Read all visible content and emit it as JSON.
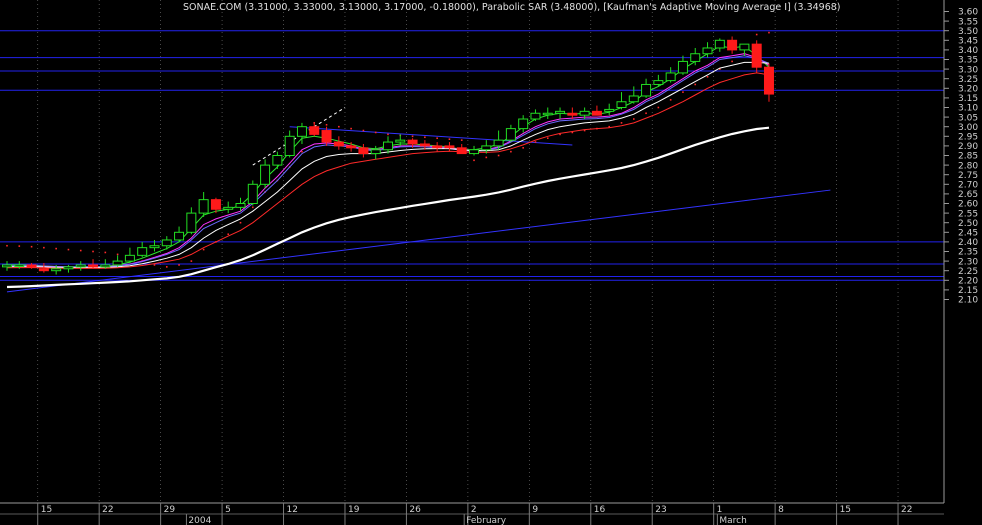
{
  "chart_data": {
    "type": "candlestick",
    "title": "SONAE.COM (3.31000, 3.33000, 3.13000, 3.17000, -0.18000), Parabolic SAR (3.48000), [Kaufman's Adaptive Moving Average I] (3.34968)",
    "ylim": [
      2.08,
      3.62
    ],
    "y_ticks": [
      2.1,
      2.15,
      2.2,
      2.25,
      2.3,
      2.35,
      2.4,
      2.45,
      2.5,
      2.55,
      2.6,
      2.65,
      2.7,
      2.75,
      2.8,
      2.85,
      2.9,
      2.95,
      3.0,
      3.05,
      3.1,
      3.15,
      3.2,
      3.25,
      3.3,
      3.35,
      3.4,
      3.45,
      3.5,
      3.55,
      3.6
    ],
    "x_week_labels": [
      {
        "index": 3,
        "label": "15"
      },
      {
        "index": 8,
        "label": "22"
      },
      {
        "index": 13,
        "label": "29"
      },
      {
        "index": 18,
        "label": "5"
      },
      {
        "index": 23,
        "label": "12"
      },
      {
        "index": 28,
        "label": "19"
      },
      {
        "index": 33,
        "label": "26"
      },
      {
        "index": 38,
        "label": "2"
      },
      {
        "index": 43,
        "label": "9"
      },
      {
        "index": 48,
        "label": "16"
      },
      {
        "index": 53,
        "label": "23"
      },
      {
        "index": 58,
        "label": "1"
      },
      {
        "index": 63,
        "label": "8"
      },
      {
        "index": 68,
        "label": "15"
      },
      {
        "index": 73,
        "label": "22"
      }
    ],
    "x_month_labels": [
      {
        "index": 14.6,
        "label": "2004"
      },
      {
        "index": 37.2,
        "label": "February"
      },
      {
        "index": 57.8,
        "label": "March"
      }
    ],
    "horizontal_lines": [
      3.5,
      3.36,
      3.29,
      3.19,
      2.4,
      2.285,
      2.22,
      2.2
    ],
    "trendlines": [
      {
        "from": [
          0,
          2.14
        ],
        "to": [
          67,
          2.67
        ],
        "color": "#3333ff"
      },
      {
        "from": [
          23,
          3.0
        ],
        "to": [
          46,
          2.905
        ],
        "color": "#3333ff"
      },
      {
        "from": [
          20,
          2.8
        ],
        "to": [
          27.5,
          3.1
        ],
        "color": "#ffffff",
        "dashed": true
      }
    ],
    "candles": {
      "open": [
        2.27,
        2.28,
        2.28,
        2.26,
        2.25,
        2.26,
        2.27,
        2.28,
        2.27,
        2.28,
        2.3,
        2.33,
        2.37,
        2.38,
        2.41,
        2.45,
        2.55,
        2.62,
        2.57,
        2.58,
        2.6,
        2.7,
        2.8,
        2.85,
        2.95,
        3.0,
        2.98,
        2.92,
        2.9,
        2.89,
        2.86,
        2.88,
        2.92,
        2.93,
        2.91,
        2.9,
        2.9,
        2.89,
        2.86,
        2.88,
        2.9,
        2.93,
        2.99,
        3.04,
        3.07,
        3.07,
        3.07,
        3.06,
        3.08,
        3.08,
        3.1,
        3.13,
        3.16,
        3.22,
        3.24,
        3.28,
        3.34,
        3.38,
        3.41,
        3.45,
        3.4,
        3.43,
        3.31
      ],
      "high": [
        2.3,
        2.3,
        2.29,
        2.29,
        2.28,
        2.28,
        2.3,
        2.31,
        2.31,
        2.33,
        2.37,
        2.4,
        2.41,
        2.43,
        2.48,
        2.58,
        2.66,
        2.63,
        2.61,
        2.63,
        2.72,
        2.83,
        2.87,
        2.98,
        3.02,
        3.02,
        3.0,
        2.95,
        2.92,
        2.91,
        2.9,
        2.95,
        2.96,
        2.94,
        2.93,
        2.92,
        2.92,
        2.91,
        2.9,
        2.93,
        2.98,
        3.01,
        3.06,
        3.09,
        3.1,
        3.1,
        3.1,
        3.1,
        3.11,
        3.12,
        3.18,
        3.21,
        3.25,
        3.27,
        3.31,
        3.37,
        3.41,
        3.44,
        3.46,
        3.47,
        3.43,
        3.45,
        3.33
      ],
      "low": [
        2.25,
        2.26,
        2.26,
        2.24,
        2.23,
        2.24,
        2.25,
        2.26,
        2.26,
        2.27,
        2.29,
        2.32,
        2.35,
        2.36,
        2.4,
        2.44,
        2.53,
        2.55,
        2.55,
        2.56,
        2.59,
        2.68,
        2.78,
        2.84,
        2.91,
        2.95,
        2.9,
        2.88,
        2.87,
        2.84,
        2.83,
        2.86,
        2.9,
        2.89,
        2.88,
        2.87,
        2.87,
        2.86,
        2.85,
        2.86,
        2.88,
        2.92,
        2.97,
        3.03,
        3.04,
        3.04,
        3.04,
        3.04,
        3.06,
        3.06,
        3.09,
        3.12,
        3.15,
        3.21,
        3.23,
        3.27,
        3.32,
        3.36,
        3.39,
        3.38,
        3.37,
        3.28,
        3.13
      ],
      "close": [
        2.28,
        2.28,
        2.27,
        2.25,
        2.26,
        2.27,
        2.28,
        2.27,
        2.28,
        2.3,
        2.33,
        2.37,
        2.38,
        2.41,
        2.45,
        2.55,
        2.62,
        2.57,
        2.58,
        2.6,
        2.7,
        2.8,
        2.85,
        2.95,
        3.0,
        2.96,
        2.92,
        2.9,
        2.89,
        2.86,
        2.88,
        2.92,
        2.93,
        2.91,
        2.9,
        2.89,
        2.89,
        2.86,
        2.88,
        2.9,
        2.93,
        2.99,
        3.04,
        3.07,
        3.07,
        3.08,
        3.06,
        3.08,
        3.06,
        3.09,
        3.13,
        3.16,
        3.22,
        3.24,
        3.28,
        3.34,
        3.38,
        3.41,
        3.45,
        3.4,
        3.43,
        3.31,
        3.17
      ]
    },
    "series": [
      {
        "style": "dotted",
        "color": "#ff2a2a",
        "values": [
          2.38,
          2.378,
          2.375,
          2.37,
          2.365,
          2.36,
          2.355,
          2.35,
          2.345,
          2.335,
          2.32,
          2.3,
          2.28,
          2.27,
          2.28,
          2.3,
          2.36,
          2.4,
          2.44,
          2.5,
          2.58,
          2.66,
          2.72,
          2.79,
          2.87,
          3.02,
          3.01,
          3.0,
          2.99,
          2.98,
          2.97,
          2.96,
          2.955,
          2.95,
          2.945,
          2.94,
          2.935,
          2.93,
          2.825,
          2.84,
          2.85,
          2.87,
          2.89,
          2.92,
          2.94,
          2.96,
          2.97,
          2.98,
          2.99,
          3.0,
          3.02,
          3.04,
          3.07,
          3.1,
          3.14,
          3.18,
          3.22,
          3.26,
          3.3,
          3.34,
          3.38,
          3.48,
          3.49
        ]
      },
      {
        "style": "line",
        "width": 1,
        "color": "#2ee82e",
        "values": [
          2.28,
          2.28,
          2.279,
          2.275,
          2.272,
          2.27,
          2.271,
          2.271,
          2.272,
          2.28,
          2.295,
          2.315,
          2.34,
          2.365,
          2.4,
          2.47,
          2.54,
          2.56,
          2.57,
          2.59,
          2.65,
          2.73,
          2.79,
          2.87,
          2.94,
          2.95,
          2.94,
          2.925,
          2.91,
          2.89,
          2.885,
          2.9,
          2.91,
          2.91,
          2.905,
          2.9,
          2.895,
          2.88,
          2.88,
          2.89,
          2.91,
          2.95,
          3.0,
          3.04,
          3.06,
          3.07,
          3.065,
          3.07,
          3.065,
          3.075,
          3.1,
          3.13,
          3.18,
          3.21,
          3.25,
          3.3,
          3.34,
          3.38,
          3.42,
          3.41,
          3.42,
          3.37,
          3.31
        ]
      },
      {
        "style": "line",
        "width": 1,
        "color": "#ff33ff",
        "values": [
          2.275,
          2.276,
          2.276,
          2.274,
          2.272,
          2.27,
          2.27,
          2.27,
          2.271,
          2.275,
          2.285,
          2.3,
          2.32,
          2.34,
          2.37,
          2.42,
          2.49,
          2.52,
          2.54,
          2.56,
          2.61,
          2.68,
          2.74,
          2.81,
          2.88,
          2.91,
          2.915,
          2.91,
          2.9,
          2.885,
          2.88,
          2.89,
          2.9,
          2.9,
          2.9,
          2.895,
          2.89,
          2.88,
          2.875,
          2.88,
          2.895,
          2.925,
          2.965,
          3.0,
          3.025,
          3.04,
          3.045,
          3.05,
          3.05,
          3.055,
          3.07,
          3.1,
          3.14,
          3.17,
          3.21,
          3.25,
          3.29,
          3.32,
          3.36,
          3.37,
          3.38,
          3.36,
          3.32
        ]
      },
      {
        "style": "line",
        "width": 1,
        "color": "#6a6aff",
        "values": [
          2.274,
          2.275,
          2.275,
          2.273,
          2.271,
          2.27,
          2.27,
          2.27,
          2.27,
          2.274,
          2.283,
          2.297,
          2.315,
          2.335,
          2.36,
          2.41,
          2.47,
          2.5,
          2.53,
          2.55,
          2.6,
          2.66,
          2.72,
          2.79,
          2.86,
          2.895,
          2.905,
          2.9,
          2.895,
          2.88,
          2.875,
          2.885,
          2.895,
          2.897,
          2.895,
          2.89,
          2.886,
          2.877,
          2.873,
          2.877,
          2.89,
          2.92,
          2.955,
          2.99,
          3.015,
          3.03,
          3.035,
          3.04,
          3.042,
          3.048,
          3.065,
          3.09,
          3.13,
          3.16,
          3.2,
          3.24,
          3.28,
          3.31,
          3.35,
          3.36,
          3.37,
          3.355,
          3.33
        ]
      },
      {
        "style": "line",
        "width": 1,
        "color": "#ffffff",
        "values": [
          2.27,
          2.271,
          2.271,
          2.27,
          2.268,
          2.266,
          2.266,
          2.266,
          2.267,
          2.27,
          2.276,
          2.286,
          2.3,
          2.315,
          2.335,
          2.37,
          2.42,
          2.46,
          2.49,
          2.52,
          2.56,
          2.61,
          2.66,
          2.72,
          2.78,
          2.82,
          2.845,
          2.855,
          2.86,
          2.86,
          2.86,
          2.868,
          2.876,
          2.882,
          2.885,
          2.886,
          2.886,
          2.88,
          2.875,
          2.875,
          2.88,
          2.9,
          2.93,
          2.96,
          2.985,
          3.0,
          3.01,
          3.02,
          3.025,
          3.03,
          3.045,
          3.065,
          3.1,
          3.13,
          3.165,
          3.2,
          3.235,
          3.27,
          3.305,
          3.32,
          3.335,
          3.335,
          3.33
        ]
      },
      {
        "style": "line",
        "width": 1,
        "color": "#ff2a2a",
        "values": [
          2.265,
          2.266,
          2.266,
          2.265,
          2.263,
          2.262,
          2.262,
          2.262,
          2.263,
          2.265,
          2.27,
          2.277,
          2.287,
          2.298,
          2.31,
          2.335,
          2.37,
          2.4,
          2.43,
          2.46,
          2.5,
          2.55,
          2.6,
          2.65,
          2.7,
          2.74,
          2.77,
          2.79,
          2.81,
          2.82,
          2.83,
          2.84,
          2.85,
          2.86,
          2.865,
          2.87,
          2.872,
          2.87,
          2.866,
          2.866,
          2.87,
          2.885,
          2.905,
          2.93,
          2.95,
          2.965,
          2.975,
          2.985,
          2.99,
          2.995,
          3.005,
          3.02,
          3.045,
          3.07,
          3.1,
          3.13,
          3.165,
          3.2,
          3.23,
          3.25,
          3.27,
          3.28,
          3.27
        ]
      },
      {
        "style": "line",
        "width": 2.2,
        "color": "#ffffff",
        "values": [
          2.165,
          2.167,
          2.17,
          2.173,
          2.176,
          2.179,
          2.182,
          2.185,
          2.188,
          2.191,
          2.195,
          2.2,
          2.205,
          2.21,
          2.218,
          2.232,
          2.25,
          2.268,
          2.285,
          2.305,
          2.33,
          2.36,
          2.39,
          2.42,
          2.45,
          2.475,
          2.497,
          2.515,
          2.53,
          2.543,
          2.555,
          2.566,
          2.577,
          2.588,
          2.598,
          2.608,
          2.618,
          2.627,
          2.636,
          2.646,
          2.658,
          2.672,
          2.688,
          2.703,
          2.717,
          2.729,
          2.74,
          2.751,
          2.762,
          2.773,
          2.785,
          2.8,
          2.818,
          2.838,
          2.86,
          2.883,
          2.905,
          2.925,
          2.945,
          2.962,
          2.976,
          2.988,
          2.995
        ]
      }
    ]
  }
}
